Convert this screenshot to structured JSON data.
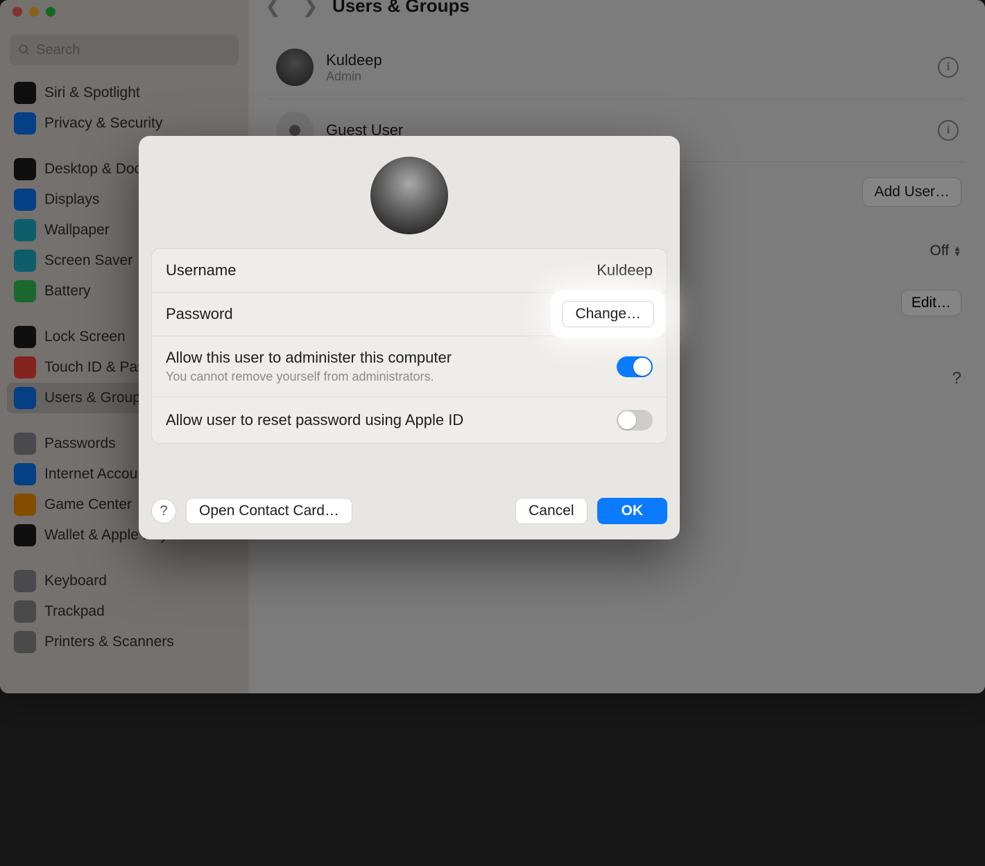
{
  "window": {
    "search_placeholder": "Search"
  },
  "sidebar": {
    "items": [
      {
        "label": "Siri & Spotlight",
        "color": "#1d1d1f"
      },
      {
        "label": "Privacy & Security",
        "color": "#0a7aff"
      },
      {
        "label": "Desktop & Dock",
        "color": "#1d1d1f"
      },
      {
        "label": "Displays",
        "color": "#0a7aff"
      },
      {
        "label": "Wallpaper",
        "color": "#18b6cc"
      },
      {
        "label": "Screen Saver",
        "color": "#18b6cc"
      },
      {
        "label": "Battery",
        "color": "#34c759"
      },
      {
        "label": "Lock Screen",
        "color": "#1d1d1f"
      },
      {
        "label": "Touch ID & Password",
        "color": "#ff453a"
      },
      {
        "label": "Users & Groups",
        "color": "#0a7aff",
        "selected": true
      },
      {
        "label": "Passwords",
        "color": "#8e8e93"
      },
      {
        "label": "Internet Accounts",
        "color": "#0a7aff"
      },
      {
        "label": "Game Center",
        "color": "#ff9500"
      },
      {
        "label": "Wallet & Apple Pay",
        "color": "#1d1d1f"
      },
      {
        "label": "Keyboard",
        "color": "#8e8e93"
      },
      {
        "label": "Trackpad",
        "color": "#8e8e93"
      },
      {
        "label": "Printers & Scanners",
        "color": "#8e8e93"
      }
    ],
    "groups": [
      [
        0,
        1
      ],
      [
        2,
        3,
        4,
        5,
        6
      ],
      [
        7,
        8,
        9
      ],
      [
        10,
        11,
        12,
        13
      ],
      [
        14,
        15,
        16
      ]
    ]
  },
  "content": {
    "title": "Users & Groups",
    "users": [
      {
        "name": "Kuldeep",
        "role": "Admin"
      },
      {
        "name": "Guest User",
        "role": ""
      }
    ],
    "add_user_label": "Add User…",
    "auto_login": {
      "label": "Off"
    },
    "edit_label": "Edit…"
  },
  "sheet": {
    "rows": {
      "username": {
        "label": "Username",
        "value": "Kuldeep"
      },
      "password": {
        "label": "Password",
        "change": "Change…"
      },
      "admin": {
        "label": "Allow this user to administer this computer",
        "sub": "You cannot remove yourself from administrators.",
        "on": true
      },
      "reset": {
        "label": "Allow user to reset password using Apple ID",
        "on": false
      }
    },
    "open_contact": "Open Contact Card…",
    "cancel": "Cancel",
    "ok": "OK"
  }
}
